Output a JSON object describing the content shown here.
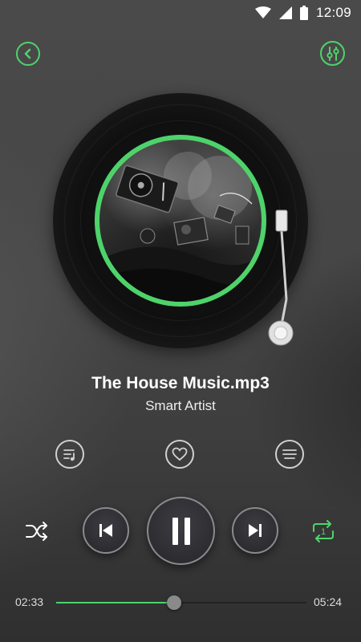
{
  "status_bar": {
    "time": "12:09",
    "icons": [
      "wifi-icon",
      "signal-icon",
      "battery-icon"
    ]
  },
  "header": {
    "back_icon": "chevron-left-icon",
    "settings_icon": "equalizer-icon"
  },
  "now_playing": {
    "title": "The House Music.mp3",
    "artist": "Smart Artist"
  },
  "actions": [
    "playlist-icon",
    "heart-icon",
    "menu-icon"
  ],
  "controls": {
    "shuffle_icon": "shuffle-icon",
    "prev_icon": "skip-previous-icon",
    "play_pause_icon": "pause-icon",
    "next_icon": "skip-next-icon",
    "repeat_icon": "repeat-one-icon",
    "repeat_badge": "1"
  },
  "progress": {
    "elapsed": "02:33",
    "total": "05:24",
    "fraction": 0.4722
  },
  "colors": {
    "accent": "#4ed36b",
    "background": "#444444"
  }
}
